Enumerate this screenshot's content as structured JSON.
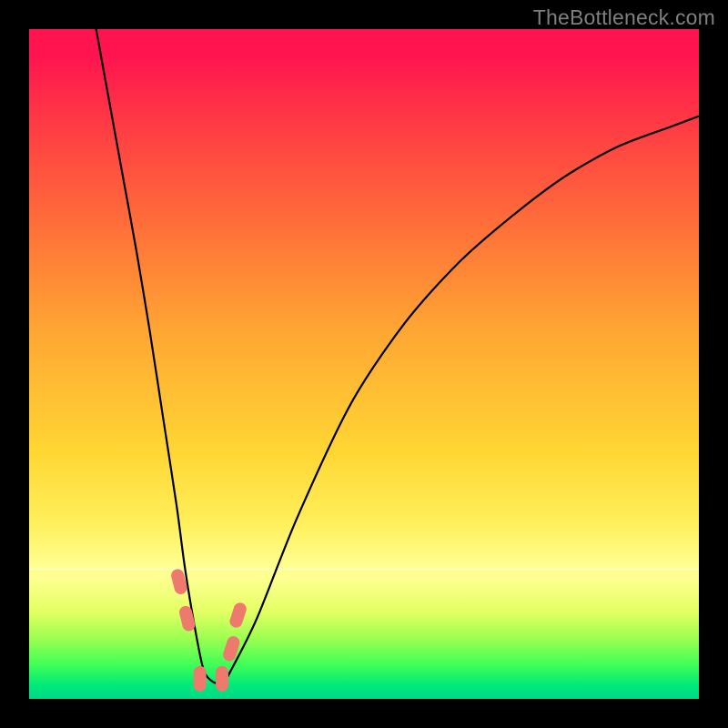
{
  "attribution": "TheBottleneck.com",
  "chart_data": {
    "type": "line",
    "title": "",
    "xlabel": "",
    "ylabel": "",
    "xlim": [
      0,
      100
    ],
    "ylim": [
      0,
      100
    ],
    "legend": false,
    "grid": false,
    "series": [
      {
        "name": "bottleneck-curve",
        "x": [
          10,
          12,
          14,
          16,
          18,
          20,
          22,
          23.2,
          24.5,
          26,
          27.5,
          29,
          30,
          34,
          40,
          48,
          56,
          64,
          72,
          80,
          88,
          96,
          100
        ],
        "values": [
          100,
          89,
          78,
          67,
          55,
          42,
          29,
          20,
          12,
          4.5,
          2.5,
          2.5,
          4,
          12,
          27,
          44,
          56,
          65,
          72,
          78,
          82.5,
          85.5,
          87
        ]
      }
    ],
    "markers": [
      {
        "name": "left-upper",
        "x": 22.4,
        "y": 17.5
      },
      {
        "name": "left-lower",
        "x": 23.6,
        "y": 12.0
      },
      {
        "name": "floor-left",
        "x": 25.5,
        "y": 3.0
      },
      {
        "name": "floor-right",
        "x": 28.8,
        "y": 3.0
      },
      {
        "name": "right-lower",
        "x": 30.2,
        "y": 7.5
      },
      {
        "name": "right-upper",
        "x": 31.2,
        "y": 12.5
      }
    ],
    "background_gradient": {
      "top": "#ff1450",
      "mid_upper": "#ff6a3a",
      "mid": "#ffd633",
      "mid_lower": "#ffff90",
      "bottom": "#00e87a"
    }
  }
}
